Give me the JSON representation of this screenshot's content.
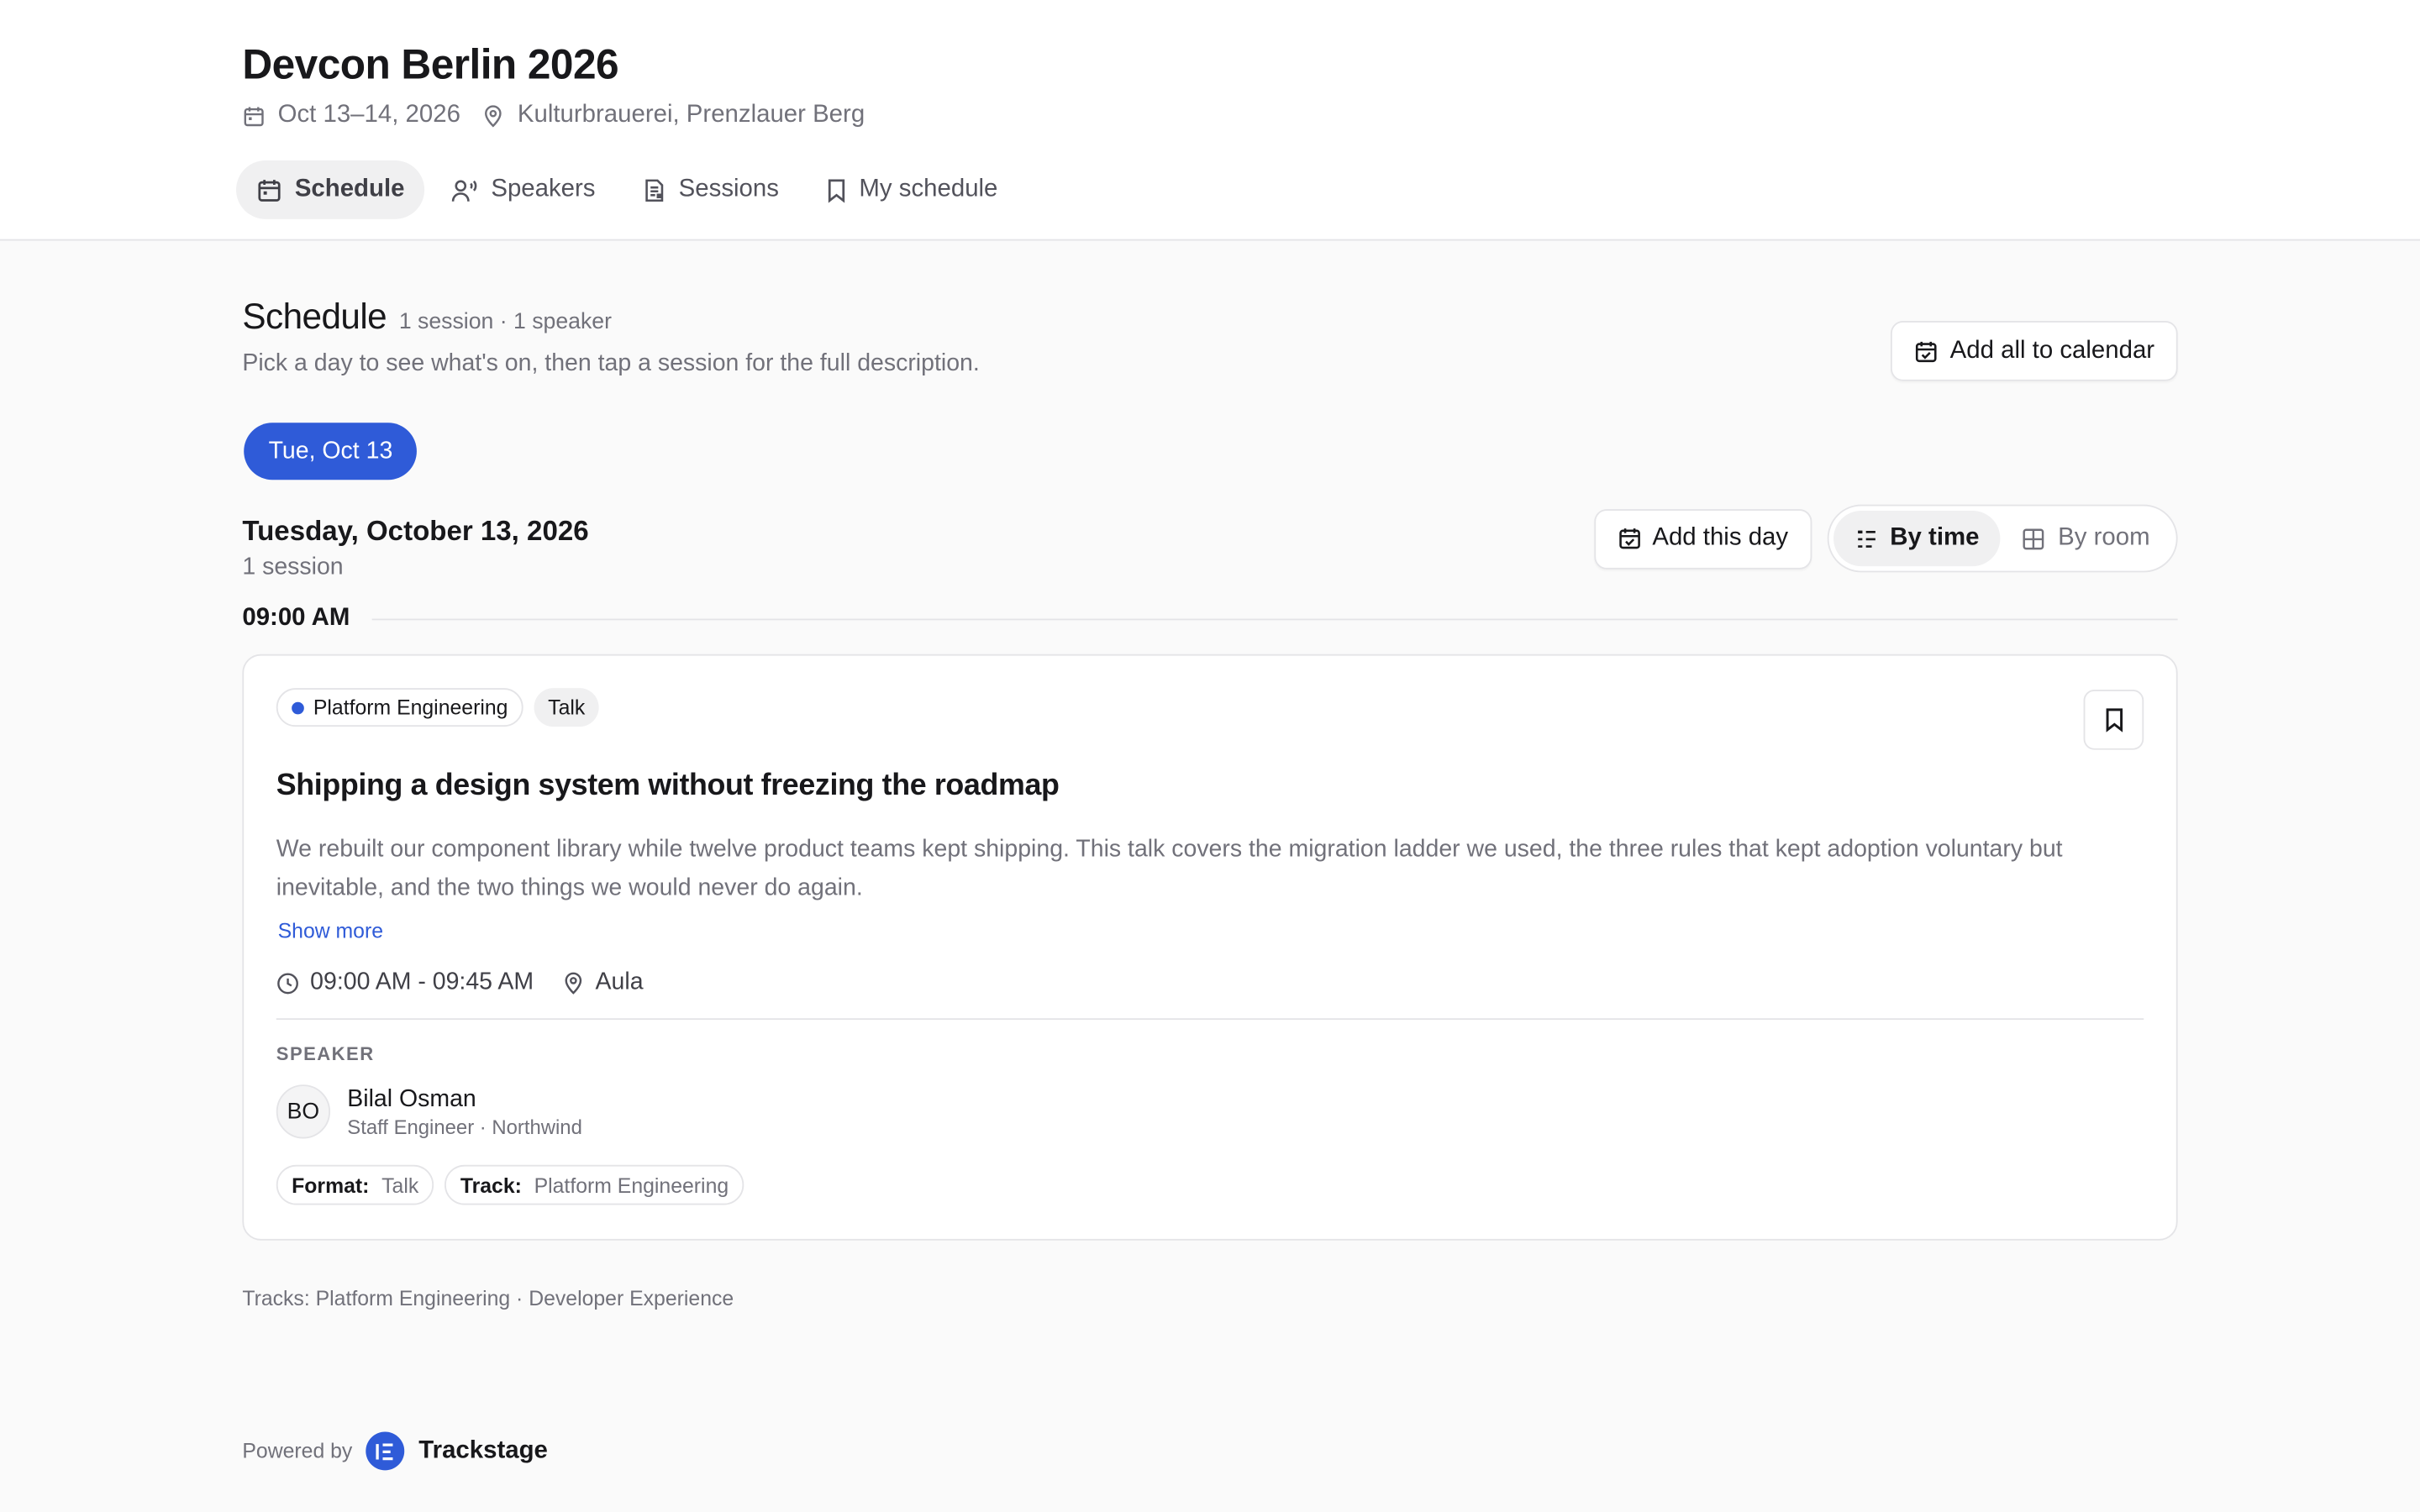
{
  "event": {
    "title": "Devcon Berlin 2026",
    "dates": "Oct 13–14, 2026",
    "venue": "Kulturbrauerei, Prenzlauer Berg"
  },
  "nav": {
    "tabs": [
      {
        "label": "Schedule",
        "icon": "calendar-icon",
        "active": true
      },
      {
        "label": "Speakers",
        "icon": "speaker-icon",
        "active": false
      },
      {
        "label": "Sessions",
        "icon": "sessions-icon",
        "active": false
      },
      {
        "label": "My schedule",
        "icon": "bookmark-icon",
        "active": false
      }
    ]
  },
  "schedule": {
    "title": "Schedule",
    "counts": "1 session · 1 speaker",
    "subtitle": "Pick a day to see what's on, then tap a session for the full description.",
    "add_all_label": "Add all to calendar"
  },
  "days": [
    {
      "label": "Tue, Oct 13",
      "selected": true
    }
  ],
  "day": {
    "title": "Tuesday, October 13, 2026",
    "count": "1 session",
    "add_day_label": "Add this day",
    "view_toggle": {
      "by_time": "By time",
      "by_room": "By room",
      "selected": "by_time"
    }
  },
  "slots": [
    {
      "time": "09:00 AM",
      "sessions": [
        {
          "track_chip": "Platform Engineering",
          "format_chip": "Talk",
          "title": "Shipping a design system without freezing the roadmap",
          "description": "We rebuilt our component library while twelve product teams kept shipping. This talk covers the migration ladder we used, the three rules that kept adoption voluntary but inevitable, and the two things we would never do again.",
          "show_more": "Show more",
          "time_range": "09:00 AM - 09:45 AM",
          "room": "Aula",
          "speaker_heading": "SPEAKER",
          "speaker": {
            "initials": "BO",
            "name": "Bilal Osman",
            "role": "Staff Engineer · Northwind"
          },
          "tags": [
            {
              "key": "Format:",
              "value": "Talk"
            },
            {
              "key": "Track:",
              "value": "Platform Engineering"
            }
          ]
        }
      ]
    }
  ],
  "footer": {
    "tracks": "Tracks: Platform Engineering · Developer Experience",
    "powered_by": "Powered by",
    "brand": "Trackstage"
  },
  "colors": {
    "accent": "#2f5bd8",
    "background": "#fafafa",
    "text": "#18181b",
    "muted": "#71717a",
    "border": "#e4e4e7"
  }
}
